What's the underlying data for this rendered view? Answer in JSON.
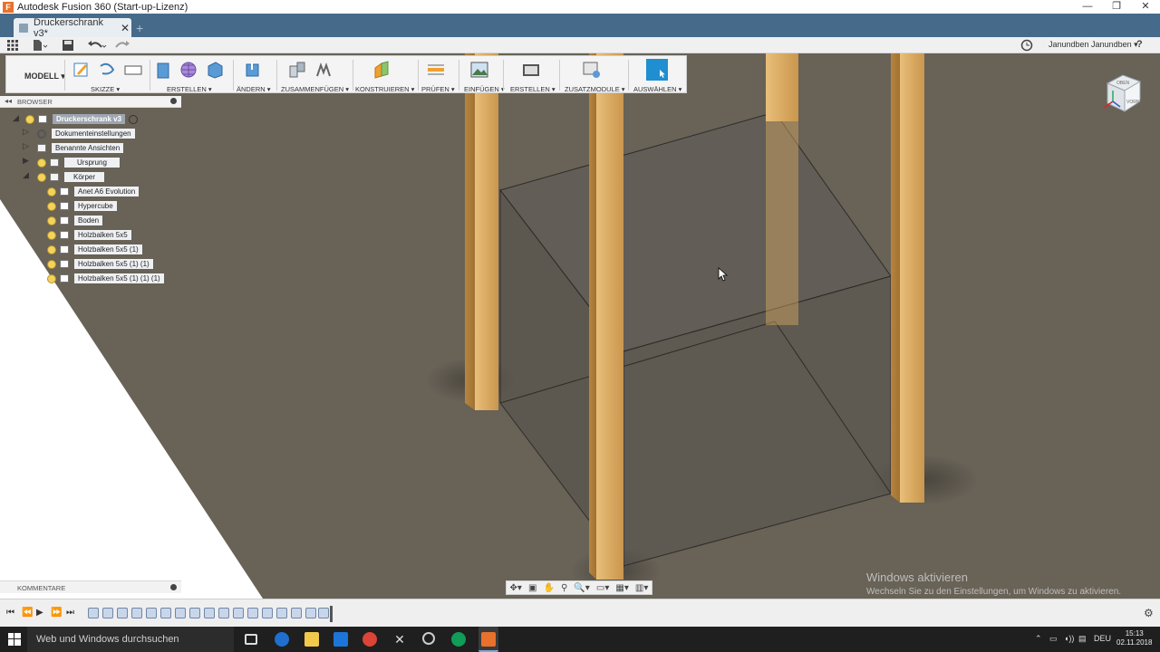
{
  "window": {
    "title": "Autodesk Fusion 360 (Start-up-Lizenz)",
    "controls": {
      "minimize": "—",
      "maximize": "❐",
      "close": "✕"
    }
  },
  "tabs": [
    {
      "label": "Druckerschrank v3*",
      "close": "✕"
    }
  ],
  "new_tab": "+",
  "user": {
    "name": "Janundben Janundben ▾",
    "help": "?"
  },
  "ribbon": {
    "mode": "MODELL ▾",
    "groups": [
      {
        "label": "SKIZZE ▾"
      },
      {
        "label": "ERSTELLEN ▾"
      },
      {
        "label": "ÄNDERN ▾"
      },
      {
        "label": "ZUSAMMENFÜGEN ▾"
      },
      {
        "label": "KONSTRUIEREN ▾"
      },
      {
        "label": "PRÜFEN ▾"
      },
      {
        "label": "EINFÜGEN ▾"
      },
      {
        "label": "ERSTELLEN ▾"
      },
      {
        "label": "ZUSATZMODULE ▾"
      },
      {
        "label": "AUSWÄHLEN ▾"
      }
    ]
  },
  "browser": {
    "title": "BROWSER",
    "root": "Druckerschrank v3",
    "items": [
      {
        "label": "Dokumenteinstellungen"
      },
      {
        "label": "Benannte Ansichten"
      },
      {
        "label": "Ursprung"
      },
      {
        "label": "Körper"
      }
    ],
    "bodies": [
      {
        "label": "Anet A6 Evolution"
      },
      {
        "label": "Hypercube"
      },
      {
        "label": "Boden"
      },
      {
        "label": "Holzbalken 5x5"
      },
      {
        "label": "Holzbalken 5x5 (1)"
      },
      {
        "label": "Holzbalken 5x5 (1) (1)"
      },
      {
        "label": "Holzbalken 5x5 (1) (1) (1)"
      }
    ]
  },
  "comments": {
    "title": "KOMMENTARE"
  },
  "viewcube": {
    "top": "OBEN",
    "front": "VORNE"
  },
  "watermark": {
    "title": "Windows aktivieren",
    "subtitle": "Wechseln Sie zu den Einstellungen, um Windows zu aktivieren."
  },
  "taskbar": {
    "search_placeholder": "Web und Windows durchsuchen",
    "language": "DEU",
    "time": "15:13",
    "date": "02.11.2018"
  },
  "colors": {
    "tabbar": "#466a8a",
    "viewport_ground": "#686257",
    "wood": "#d9aa62",
    "selection_blue": "#1f8fd1"
  }
}
